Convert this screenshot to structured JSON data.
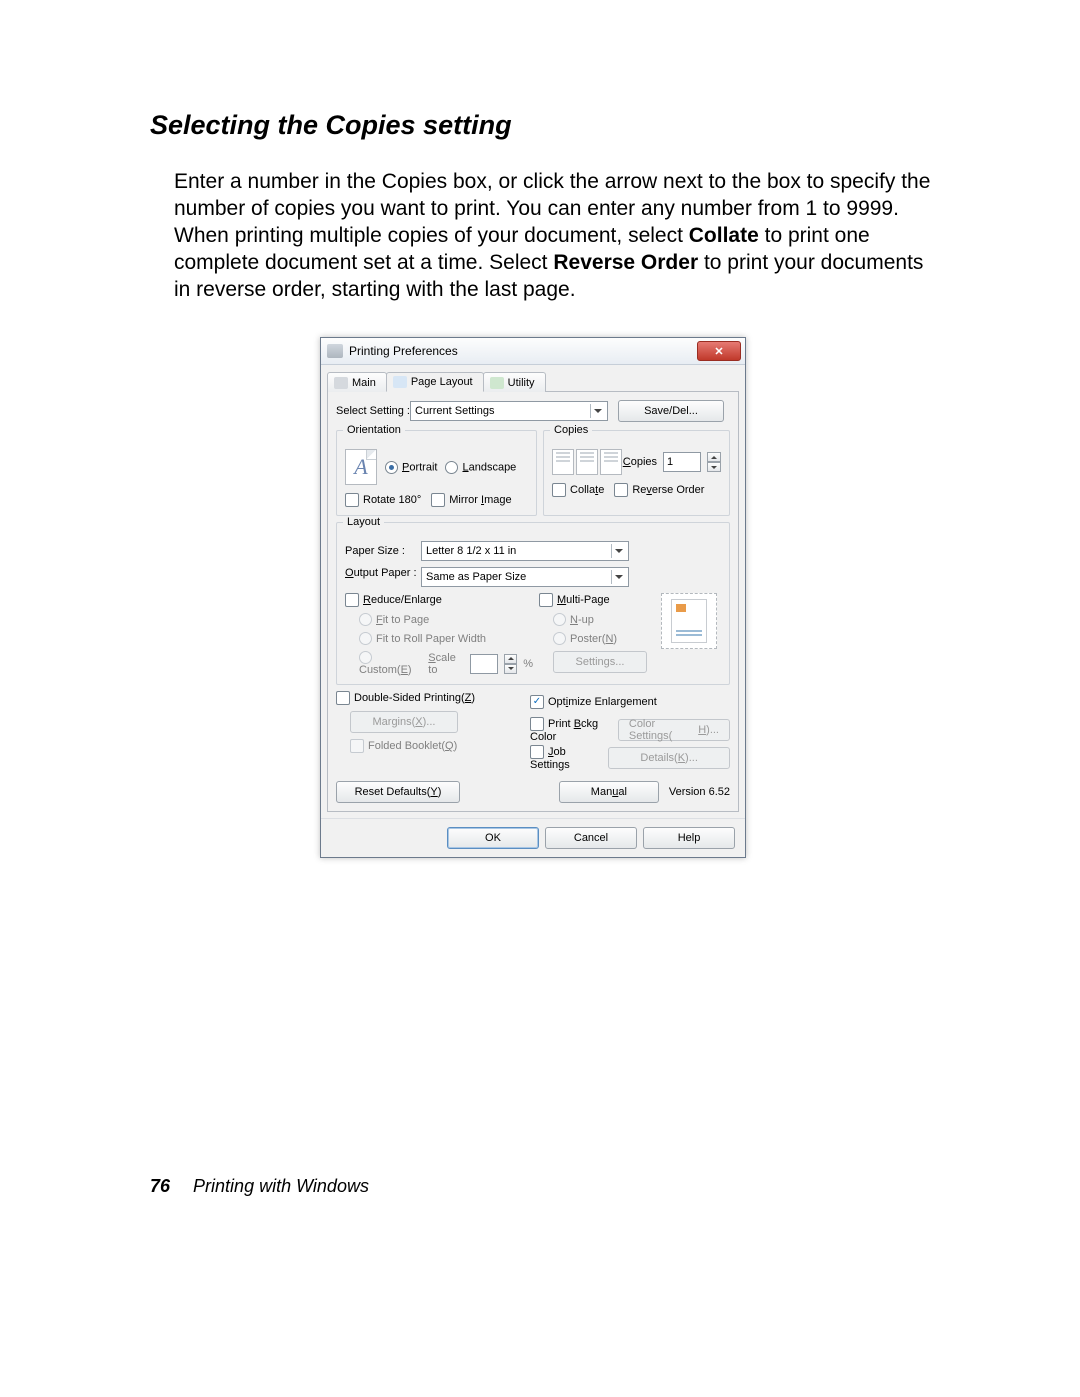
{
  "heading": "Selecting the Copies setting",
  "body_html": "Enter a number in the Copies box, or click the arrow next to the box to specify the number of copies you want to print. You can enter any number from 1 to 9999. When printing multiple copies of your document, select <b>Collate</b> to print one complete document set at a time. Select <b>Reverse Order</b> to print your documents in reverse order, starting with the last page.",
  "dialog": {
    "title": "Printing Preferences",
    "tabs": {
      "main": "Main",
      "page_layout": "Page Layout",
      "utility": "Utility"
    },
    "select_setting": {
      "label": "Select Setting :",
      "value": "Current Settings",
      "save_del": "Save/Del..."
    },
    "orientation": {
      "legend": "Orientation",
      "preview_letter": "A",
      "portrait": "Portrait",
      "landscape": "Landscape",
      "rotate": "Rotate 180°",
      "mirror": "Mirror Image"
    },
    "copies": {
      "legend": "Copies",
      "copies_label": "Copies",
      "value": "1",
      "collate": "Collate",
      "reverse": "Reverse Order"
    },
    "layout": {
      "legend": "Layout",
      "paper_size_label": "Paper Size :",
      "paper_size_value": "Letter 8 1/2 x 11 in",
      "output_paper_label": "Output Paper :",
      "output_paper_value": "Same as Paper Size",
      "reduce_enlarge": "Reduce/Enlarge",
      "fit_to_page": "Fit to Page",
      "fit_to_roll": "Fit to Roll Paper Width",
      "custom": "Custom(E)",
      "scale_to": "Scale to",
      "scale_pct": "%",
      "multi_page": "Multi-Page",
      "nup": "N-up",
      "poster": "Poster(N)",
      "settings_btn": "Settings..."
    },
    "dsp": {
      "double_sided": "Double-Sided Printing(Z)",
      "margins_btn": "Margins(X)...",
      "folded_booklet": "Folded Booklet(Q)"
    },
    "opts": {
      "optimize": "Optimize Enlargement",
      "print_bckg": "Print Bckg Color",
      "color_settings_btn": "Color Settings(H)...",
      "job_settings": "Job Settings",
      "details_btn": "Details(K)..."
    },
    "footer": {
      "reset_btn": "Reset Defaults(Y)",
      "manual_btn": "Manual",
      "version": "Version 6.52"
    },
    "buttons": {
      "ok": "OK",
      "cancel": "Cancel",
      "help": "Help"
    }
  },
  "page_footer": {
    "number": "76",
    "chapter": "Printing with Windows"
  }
}
